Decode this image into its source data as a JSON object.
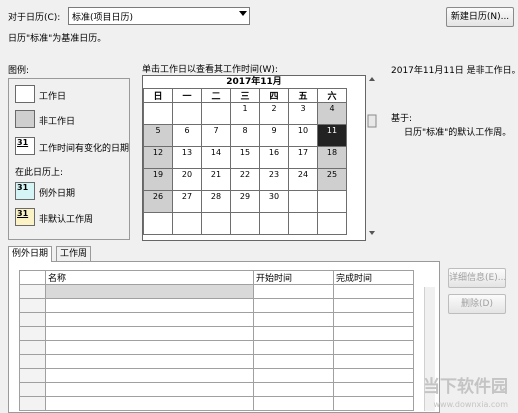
{
  "header": {
    "for_calendar_label": "对于日历(C):",
    "calendar_select_value": "标准(项目日历)",
    "new_calendar_button": "新建日历(N)...",
    "base_text": "日历\"标准\"为基准日历。"
  },
  "legend": {
    "title": "图例:",
    "working": "工作日",
    "nonworking": "非工作日",
    "edited": "工作时间有变化的日期",
    "on_this_calendar": "在此日历上:",
    "exception": "例外日期",
    "nondefault_week": "非默认工作周",
    "sample_day": "31"
  },
  "calendar": {
    "instruction": "单击工作日以查看其工作时间(W):",
    "month_title": "2017年11月",
    "weekdays": [
      "日",
      "一",
      "二",
      "三",
      "四",
      "五",
      "六"
    ],
    "weeks": [
      [
        {
          "d": "",
          "t": "e"
        },
        {
          "d": "",
          "t": "e"
        },
        {
          "d": "",
          "t": "e"
        },
        {
          "d": "1",
          "t": "w"
        },
        {
          "d": "2",
          "t": "w"
        },
        {
          "d": "3",
          "t": "w"
        },
        {
          "d": "4",
          "t": "n"
        }
      ],
      [
        {
          "d": "5",
          "t": "n"
        },
        {
          "d": "6",
          "t": "w"
        },
        {
          "d": "7",
          "t": "w"
        },
        {
          "d": "8",
          "t": "w"
        },
        {
          "d": "9",
          "t": "w"
        },
        {
          "d": "10",
          "t": "w"
        },
        {
          "d": "11",
          "t": "s"
        }
      ],
      [
        {
          "d": "12",
          "t": "n"
        },
        {
          "d": "13",
          "t": "w"
        },
        {
          "d": "14",
          "t": "w"
        },
        {
          "d": "15",
          "t": "w"
        },
        {
          "d": "16",
          "t": "w"
        },
        {
          "d": "17",
          "t": "w"
        },
        {
          "d": "18",
          "t": "n"
        }
      ],
      [
        {
          "d": "19",
          "t": "n"
        },
        {
          "d": "20",
          "t": "w"
        },
        {
          "d": "21",
          "t": "w"
        },
        {
          "d": "22",
          "t": "w"
        },
        {
          "d": "23",
          "t": "w"
        },
        {
          "d": "24",
          "t": "w"
        },
        {
          "d": "25",
          "t": "n"
        }
      ],
      [
        {
          "d": "26",
          "t": "n"
        },
        {
          "d": "27",
          "t": "w"
        },
        {
          "d": "28",
          "t": "w"
        },
        {
          "d": "29",
          "t": "w"
        },
        {
          "d": "30",
          "t": "w"
        },
        {
          "d": "",
          "t": "e"
        },
        {
          "d": "",
          "t": "e"
        }
      ],
      [
        {
          "d": "",
          "t": "e"
        },
        {
          "d": "",
          "t": "e"
        },
        {
          "d": "",
          "t": "e"
        },
        {
          "d": "",
          "t": "e"
        },
        {
          "d": "",
          "t": "e"
        },
        {
          "d": "",
          "t": "e"
        },
        {
          "d": "",
          "t": "e"
        }
      ]
    ]
  },
  "info": {
    "status": "2017年11月11日 是非工作日。",
    "based_on_label": "基于:",
    "based_on_text": "日历\"标准\"的默认工作周。"
  },
  "tabs": [
    "例外日期",
    "工作周"
  ],
  "exceptions_table": {
    "columns": [
      "名称",
      "开始时间",
      "完成时间"
    ],
    "row_count": 9
  },
  "side_buttons": {
    "details": "详细信息(E)...",
    "delete": "删除(D)"
  },
  "watermark": {
    "main": "当下软件园",
    "url": "www.downxia.com"
  }
}
